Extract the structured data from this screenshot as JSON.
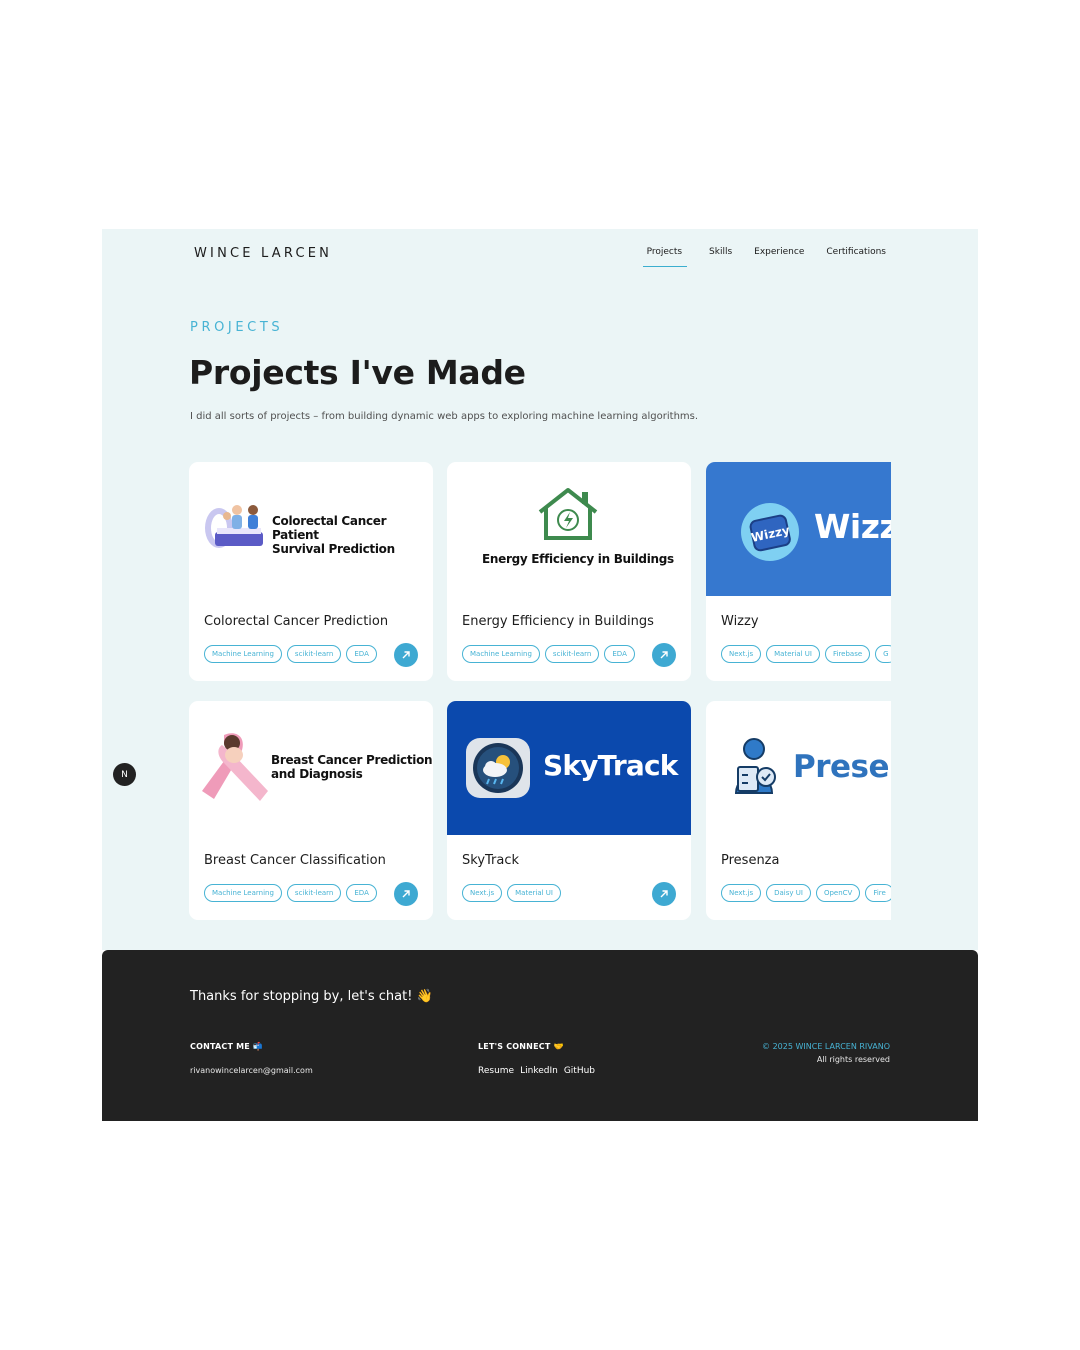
{
  "brand": "WINCE LARCEN",
  "nav": [
    "Projects",
    "Skills",
    "Experience",
    "Certifications"
  ],
  "section": {
    "kicker": "PROJECTS",
    "title": "Projects I've Made",
    "subtitle": "I did all sorts of projects – from building dynamic web apps to exploring machine learning algorithms."
  },
  "projects": [
    {
      "name": "Colorectal Cancer Prediction",
      "thumb_text": [
        "Colorectal Cancer Patient",
        "Survival Prediction"
      ],
      "tags": [
        "Machine Learning",
        "scikit-learn",
        "EDA"
      ]
    },
    {
      "name": "Energy Efficiency in Buildings",
      "thumb_text": [
        "Energy Efficiency in Buildings"
      ],
      "tags": [
        "Machine Learning",
        "scikit-learn",
        "EDA"
      ]
    },
    {
      "name": "Wizzy",
      "thumb_text": [
        "Wizzy",
        "Wizzy"
      ],
      "tags": [
        "Next.js",
        "Material UI",
        "Firebase",
        "G"
      ]
    },
    {
      "name": "Breast Cancer Classification",
      "thumb_text": [
        "Breast Cancer Prediction",
        "and Diagnosis"
      ],
      "tags": [
        "Machine Learning",
        "scikit-learn",
        "EDA"
      ]
    },
    {
      "name": "SkyTrack",
      "thumb_text": [
        "SkyTrack"
      ],
      "tags": [
        "Next.js",
        "Material UI"
      ]
    },
    {
      "name": "Presenza",
      "thumb_text": [
        "Presen"
      ],
      "tags": [
        "Next.js",
        "Daisy UI",
        "OpenCV",
        "Fire"
      ]
    }
  ],
  "badge": "N",
  "footer": {
    "heading": "Thanks for stopping by, let's chat! 👋",
    "contact_title": "CONTACT ME 📬",
    "email": "rivanowincelarcen@gmail.com",
    "connect_title": "LET'S CONNECT 🤝",
    "links": [
      "Resume",
      "LinkedIn",
      "GitHub"
    ],
    "copyright": "© 2025 WINCE LARCEN RIVANO",
    "rights": "All rights reserved"
  },
  "colors": {
    "accent": "#47b3d4",
    "wizzy_bg": "#3678cf",
    "skytrack_bg": "#0b49ad",
    "footer_bg": "#222222",
    "page_bg": "#ebf5f6"
  }
}
